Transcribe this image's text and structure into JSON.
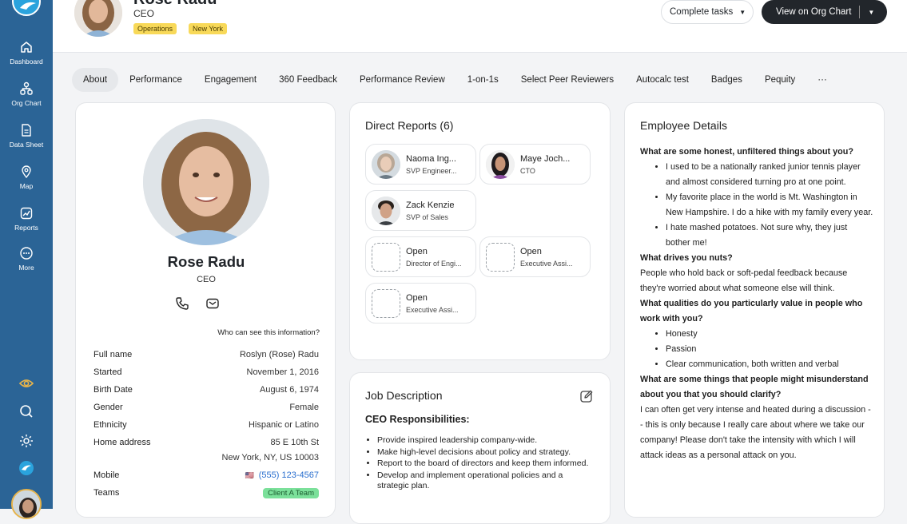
{
  "sidebar": {
    "items": [
      {
        "label": "Dashboard",
        "icon": "home-icon"
      },
      {
        "label": "Org Chart",
        "icon": "org-chart-icon"
      },
      {
        "label": "Data Sheet",
        "icon": "data-sheet-icon"
      },
      {
        "label": "Map",
        "icon": "map-pin-icon"
      },
      {
        "label": "Reports",
        "icon": "reports-icon"
      },
      {
        "label": "More",
        "icon": "more-icon"
      }
    ],
    "bottom_icons": [
      "eye-icon",
      "search-icon",
      "settings-icon",
      "app-logo-icon"
    ]
  },
  "header": {
    "name": "Rose Radu",
    "title": "CEO",
    "tags": [
      "Operations",
      "New York"
    ],
    "complete_tasks_label": "Complete tasks",
    "org_chart_label": "View on Org Chart"
  },
  "tabs": [
    "About",
    "Performance",
    "Engagement",
    "360 Feedback",
    "Performance Review",
    "1-on-1s",
    "Select Peer Reviewers",
    "Autocalc test",
    "Badges",
    "Pequity",
    "···"
  ],
  "profile": {
    "name": "Rose Radu",
    "title": "CEO",
    "who_can_see": "Who can see this information?",
    "details": [
      {
        "label": "Full name",
        "value": "Roslyn (Rose) Radu"
      },
      {
        "label": "Started",
        "value": "November 1, 2016"
      },
      {
        "label": "Birth Date",
        "value": "August 6, 1974"
      },
      {
        "label": "Gender",
        "value": "Female"
      },
      {
        "label": "Ethnicity",
        "value": "Hispanic or Latino"
      }
    ],
    "address_label": "Home address",
    "address_line1": "85 E 10th St",
    "address_line2": "New York, NY, US 10003",
    "mobile_label": "Mobile",
    "mobile_flag": "🇺🇸",
    "mobile_value": "(555) 123-4567",
    "teams_label": "Teams",
    "team_value": "Client A Team"
  },
  "direct_reports": {
    "title": "Direct Reports (6)",
    "items": [
      {
        "name": "Naoma Ing...",
        "role": "SVP Engineer..."
      },
      {
        "name": "Maye Joch...",
        "role": "CTO"
      },
      {
        "name": "Zack Kenzie",
        "role": "SVP of Sales"
      },
      {
        "name": "Open",
        "role": "Director of Engi..."
      },
      {
        "name": "Open",
        "role": "Executive Assi..."
      },
      {
        "name": "Open",
        "role": "Executive Assi..."
      }
    ]
  },
  "job_description": {
    "title": "Job Description",
    "subtitle": "CEO Responsibilities:",
    "items": [
      "Provide inspired leadership company-wide.",
      "Make high-level decisions about policy and strategy.",
      "Report to the board of directors and keep them informed.",
      "Develop and implement operational policies and a strategic plan."
    ]
  },
  "employee_details": {
    "title": "Employee Details",
    "q1": "What are some honest, unfiltered things about you?",
    "q1_items": [
      "I used to be a nationally ranked junior tennis player and almost considered turning pro at one point.",
      "My favorite place in the world is Mt. Washington in New Hampshire. I do a hike with my family every year.",
      "I hate mashed potatoes. Not sure why, they just bother me!"
    ],
    "q2": "What drives you nuts?",
    "a2": "People who hold back or soft-pedal feedback because they're worried about what someone else will think.",
    "q3": "What qualities do you particularly value in people who work with you?",
    "q3_items": [
      "Honesty",
      "Passion",
      "Clear communication, both written and verbal"
    ],
    "q4": "What are some things that people might misunderstand about you that you should clarify?",
    "a4": "I can often get very intense and heated during a discussion -- this is only because I really care about where we take our company! Please don't take the intensity with which I will attack ideas as a personal attack on you."
  },
  "colors": {
    "sidebar": "#2b6496",
    "tag": "#f8d959",
    "team_badge": "#7be09a",
    "link": "#2a6fcf"
  }
}
